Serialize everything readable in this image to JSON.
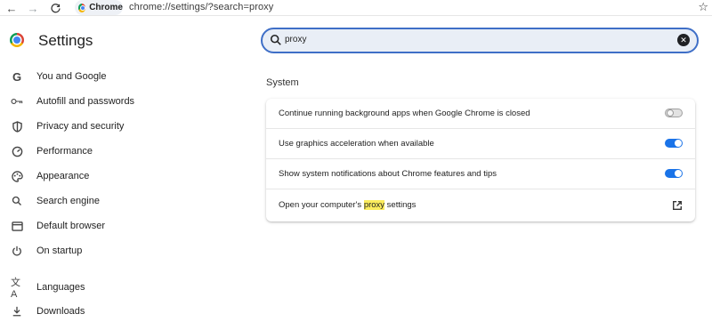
{
  "browser": {
    "chip_label": "Chrome",
    "url": "chrome://settings/?search=proxy"
  },
  "header": {
    "title": "Settings"
  },
  "search": {
    "value": "proxy"
  },
  "sidebar": {
    "items": [
      {
        "label": "You and Google",
        "icon": "google-g-icon"
      },
      {
        "label": "Autofill and passwords",
        "icon": "key-icon"
      },
      {
        "label": "Privacy and security",
        "icon": "shield-icon"
      },
      {
        "label": "Performance",
        "icon": "speedometer-icon"
      },
      {
        "label": "Appearance",
        "icon": "palette-icon"
      },
      {
        "label": "Search engine",
        "icon": "search-icon"
      },
      {
        "label": "Default browser",
        "icon": "browser-window-icon"
      },
      {
        "label": "On startup",
        "icon": "power-icon"
      },
      {
        "label": "Languages",
        "icon": "translate-icon"
      },
      {
        "label": "Downloads",
        "icon": "download-icon"
      }
    ]
  },
  "main": {
    "section_label": "System",
    "rows": [
      {
        "text": "Continue running background apps when Google Chrome is closed",
        "toggle": "off"
      },
      {
        "text": "Use graphics acceleration when available",
        "toggle": "on"
      },
      {
        "text": "Show system notifications about Chrome features and tips",
        "toggle": "on"
      },
      {
        "text_before": "Open your computer's ",
        "highlight": "proxy",
        "text_after": " settings",
        "action": "external-link-icon"
      }
    ]
  },
  "colors": {
    "accent": "#1a73e8",
    "search_border": "#3f6fc7",
    "search_bg": "#e9eef6",
    "highlight": "#fbec5d"
  }
}
